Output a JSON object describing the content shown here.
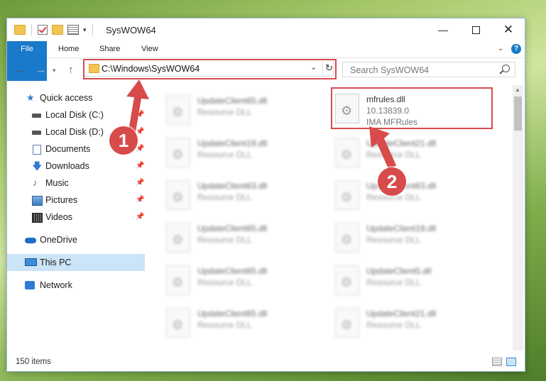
{
  "window": {
    "title": "SysWOW64"
  },
  "ribbon": {
    "tabs": [
      "File",
      "Home",
      "Share",
      "View"
    ]
  },
  "address": {
    "path": "C:\\Windows\\SysWOW64"
  },
  "search": {
    "placeholder": "Search SysWOW64"
  },
  "sidebar": {
    "items": [
      {
        "label": "Quick access",
        "icon": "star-icon"
      },
      {
        "label": "Local Disk (C:)",
        "icon": "drive-icon",
        "pinned": true
      },
      {
        "label": "Local Disk (D:)",
        "icon": "drive-icon",
        "pinned": true
      },
      {
        "label": "Documents",
        "icon": "documents-icon",
        "pinned": true
      },
      {
        "label": "Downloads",
        "icon": "downloads-icon",
        "pinned": true
      },
      {
        "label": "Music",
        "icon": "music-icon",
        "pinned": true
      },
      {
        "label": "Pictures",
        "icon": "pictures-icon",
        "pinned": true
      },
      {
        "label": "Videos",
        "icon": "videos-icon",
        "pinned": true
      },
      {
        "label": "OneDrive",
        "icon": "onedrive-icon"
      },
      {
        "label": "This PC",
        "icon": "pc-icon",
        "selected": true
      },
      {
        "label": "Network",
        "icon": "network-icon"
      }
    ]
  },
  "files": {
    "highlighted": {
      "name": "mfrules.dll",
      "version": "10.13839.0",
      "description": "IMA MFRules"
    },
    "col1": [
      {
        "name": "UpdateClient65.dll",
        "type": "Resource DLL"
      },
      {
        "name": "UpdateClient19.dll",
        "type": "Resource DLL"
      },
      {
        "name": "UpdateClient63.dll",
        "type": "Resource DLL"
      },
      {
        "name": "UpdateClient65.dll",
        "type": "Resource DLL"
      },
      {
        "name": "UpdateClient65.dll",
        "type": "Resource DLL"
      },
      {
        "name": "UpdateClient65.dll",
        "type": "Resource DLL"
      }
    ],
    "col2": [
      {
        "name": "UpdateClient21.dll",
        "type": "Resource DLL"
      },
      {
        "name": "UpdateClient63.dll",
        "type": "Resource DLL"
      },
      {
        "name": "UpdateClient19.dll",
        "type": "Resource DLL"
      },
      {
        "name": "UpdateClient5.dll",
        "type": "Resource DLL"
      },
      {
        "name": "UpdateClient21.dll",
        "type": "Resource DLL"
      }
    ]
  },
  "status": {
    "count": "150 items"
  },
  "callouts": [
    "1",
    "2"
  ],
  "colors": {
    "accent": "#1979ca",
    "highlight": "#d84b4b",
    "selected": "#cce4f7"
  }
}
